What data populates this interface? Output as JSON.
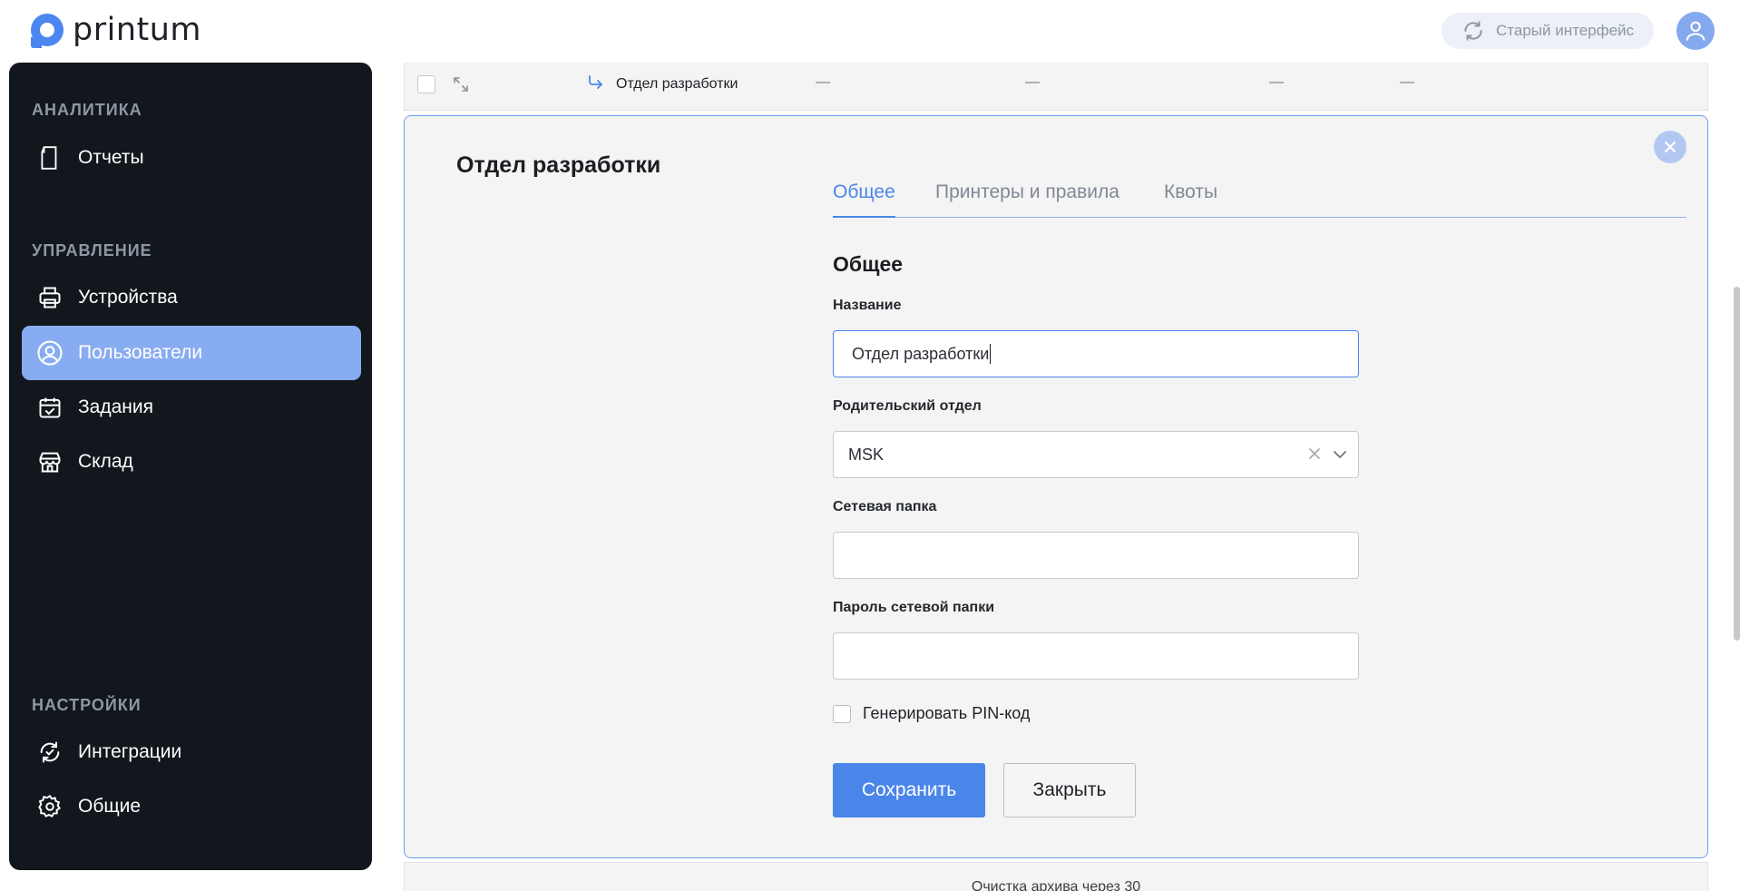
{
  "header": {
    "logo_text": "printum",
    "old_ui_label": "Старый интерфейс",
    "accent": "#4a86ea"
  },
  "sidebar": {
    "sections": [
      {
        "title": "АНАЛИТИКА",
        "items": [
          {
            "label": "Отчеты",
            "icon": "document-icon"
          }
        ]
      },
      {
        "title": "УПРАВЛЕНИЕ",
        "items": [
          {
            "label": "Устройства",
            "icon": "printer-icon"
          },
          {
            "label": "Пользователи",
            "icon": "user-icon",
            "active": true
          },
          {
            "label": "Задания",
            "icon": "calendar-check-icon"
          },
          {
            "label": "Склад",
            "icon": "store-icon"
          }
        ]
      },
      {
        "title": "НАСТРОЙКИ",
        "items": [
          {
            "label": "Интеграции",
            "icon": "sync-icon"
          },
          {
            "label": "Общие",
            "icon": "gear-icon"
          }
        ]
      }
    ]
  },
  "table_row": {
    "name": "Отдел разработки",
    "dashes": [
      "—",
      "—",
      "—",
      "—"
    ]
  },
  "panel": {
    "title": "Отдел разработки",
    "tabs": [
      {
        "label": "Общее",
        "active": true
      },
      {
        "label": "Принтеры и правила"
      },
      {
        "label": "Квоты"
      }
    ],
    "section_heading": "Общее",
    "fields": {
      "name_label": "Название",
      "name_value": "Отдел разработки",
      "parent_label": "Родительский отдел",
      "parent_value": "MSK",
      "folder_label": "Сетевая папка",
      "folder_value": "",
      "password_label": "Пароль сетевой папки",
      "password_value": ""
    },
    "pin_checkbox_label": "Генерировать PIN-код",
    "pin_checked": false,
    "save_label": "Сохранить",
    "close_label": "Закрыть"
  },
  "footer": {
    "text": "Очистка архива через 30"
  }
}
